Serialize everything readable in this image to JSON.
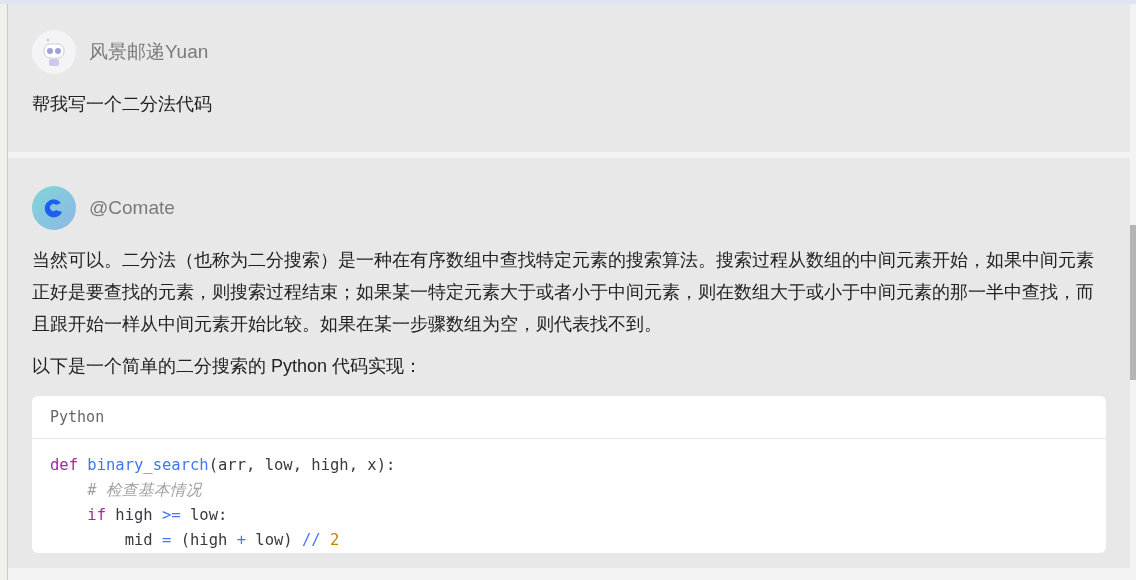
{
  "messages": [
    {
      "author": "风景邮递Yuan",
      "kind": "user",
      "paragraphs": [
        "帮我写一个二分法代码"
      ]
    },
    {
      "author": "@Comate",
      "kind": "bot",
      "paragraphs": [
        "当然可以。二分法（也称为二分搜索）是一种在有序数组中查找特定元素的搜索算法。搜索过程从数组的中间元素开始，如果中间元素正好是要查找的元素，则搜索过程结束；如果某一特定元素大于或者小于中间元素，则在数组大于或小于中间元素的那一半中查找，而且跟开始一样从中间元素开始比较。如果在某一步骤数组为空，则代表找不到。",
        "以下是一个简单的二分搜索的 Python 代码实现："
      ],
      "code": {
        "language": "Python",
        "lines": [
          [
            {
              "kind": "keyword",
              "text": "def"
            },
            {
              "kind": "function",
              "text": " binary_search"
            },
            {
              "kind": "plain",
              "text": "(arr, low, high, x):"
            }
          ],
          [
            {
              "kind": "comment",
              "text": "    # 检查基本情况"
            }
          ],
          [
            {
              "kind": "keyword",
              "text": "    if"
            },
            {
              "kind": "plain",
              "text": " high "
            },
            {
              "kind": "operator",
              "text": ">="
            },
            {
              "kind": "plain",
              "text": " low:"
            }
          ],
          [
            {
              "kind": "plain",
              "text": "        mid "
            },
            {
              "kind": "operator",
              "text": "="
            },
            {
              "kind": "plain",
              "text": " (high "
            },
            {
              "kind": "operator",
              "text": "+"
            },
            {
              "kind": "plain",
              "text": " low) "
            },
            {
              "kind": "operator",
              "text": "//"
            },
            {
              "kind": "number",
              "text": " 2"
            }
          ]
        ]
      }
    }
  ]
}
